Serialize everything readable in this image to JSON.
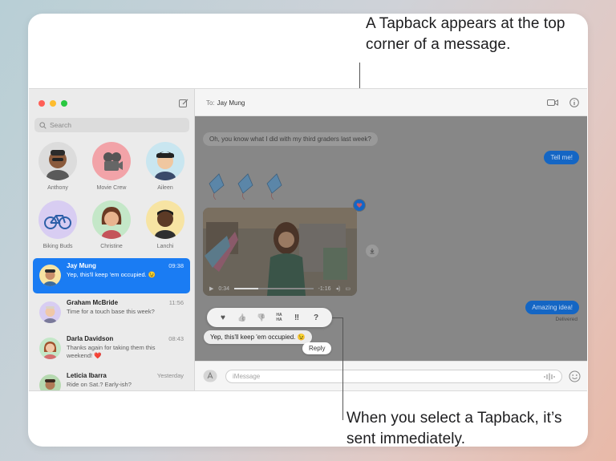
{
  "callouts": {
    "top": "A Tapback appears at the top corner of a message.",
    "bottom": "When you select a Tapback, it’s sent immediately."
  },
  "sidebar": {
    "search_placeholder": "Search",
    "pinned": [
      {
        "name": "Anthony",
        "bg": "#dcdcdc"
      },
      {
        "name": "Movie Crew",
        "bg": "#f2a3a8"
      },
      {
        "name": "Aileen",
        "bg": "#c9e6f0"
      },
      {
        "name": "Biking Buds",
        "bg": "#d8cdf2"
      },
      {
        "name": "Christine",
        "bg": "#c4e7c8"
      },
      {
        "name": "Lanchi",
        "bg": "#f7e4a3"
      }
    ],
    "conversations": [
      {
        "name": "Jay Mung",
        "time": "09:38",
        "preview": "Yep, this'll keep 'em occupied. 😉",
        "selected": true
      },
      {
        "name": "Graham McBride",
        "time": "11:56",
        "preview": "Time for a touch base this week?"
      },
      {
        "name": "Darla Davidson",
        "time": "08:43",
        "preview": "Thanks again for taking them this weekend! ❤️"
      },
      {
        "name": "Leticia Ibarra",
        "time": "Yesterday",
        "preview": "Ride on Sat.? Early-ish?"
      }
    ]
  },
  "chat": {
    "to_label": "To:",
    "recipient": "Jay Mung",
    "messages": {
      "in1": "Oh, you know what I did with my third graders last week?",
      "out1": "Tell me!",
      "kites": "🪁 🪁 🪁",
      "video_time_start": "0:34",
      "video_time_end": "-1:16",
      "out2": "Amazing idea!",
      "delivered": "Delivered",
      "in2": "Yep, this'll keep 'em occupied. 😉"
    },
    "tapbacks": [
      "♥",
      "👍",
      "👎",
      "HA HA",
      "‼",
      "?"
    ],
    "reply_label": "Reply",
    "input_placeholder": "iMessage"
  },
  "colors": {
    "accent": "#1a7cf3",
    "close": "#ff5f57",
    "minimize": "#febc2e",
    "zoom": "#28c840"
  }
}
